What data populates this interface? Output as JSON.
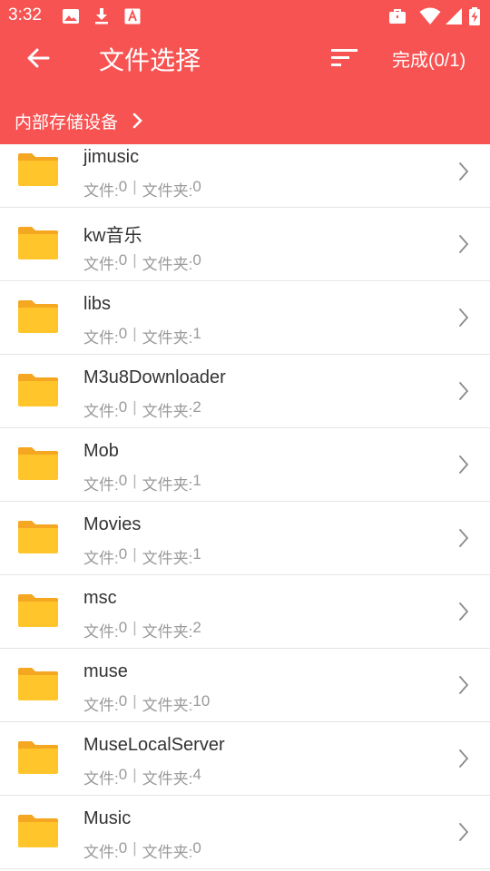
{
  "status_bar": {
    "time": "3:32",
    "left_icons": [
      "image-icon",
      "download-icon",
      "font-a-icon"
    ],
    "right_icons": [
      "briefcase-icon",
      "wifi-icon",
      "signal-icon",
      "battery-charging-icon"
    ]
  },
  "toolbar": {
    "title": "文件选择",
    "done_label": "完成(0/1)",
    "icons": [
      "arrow-left-icon",
      "sort-icon"
    ]
  },
  "breadcrumb": {
    "label": "内部存储设备"
  },
  "colors": {
    "header_bg": "#f75353",
    "folder_yellow": "#ffc52a",
    "folder_tab": "#f5a722"
  },
  "labels": {
    "files_prefix": "文件:",
    "folders_prefix": "文件夹:",
    "separator": "|"
  },
  "folders": [
    {
      "name": "jimusic",
      "files": "0",
      "subfolders": "0"
    },
    {
      "name": "kw音乐",
      "files": "0",
      "subfolders": "0"
    },
    {
      "name": "libs",
      "files": "0",
      "subfolders": "1"
    },
    {
      "name": "M3u8Downloader",
      "files": "0",
      "subfolders": "2"
    },
    {
      "name": "Mob",
      "files": "0",
      "subfolders": "1"
    },
    {
      "name": "Movies",
      "files": "0",
      "subfolders": "1"
    },
    {
      "name": "msc",
      "files": "0",
      "subfolders": "2"
    },
    {
      "name": "muse",
      "files": "0",
      "subfolders": "10"
    },
    {
      "name": "MuseLocalServer",
      "files": "0",
      "subfolders": "4"
    },
    {
      "name": "Music",
      "files": "0",
      "subfolders": "0"
    }
  ]
}
